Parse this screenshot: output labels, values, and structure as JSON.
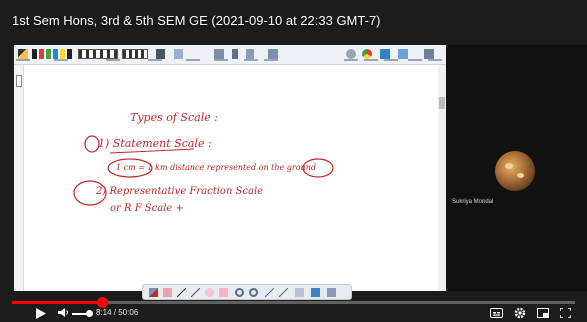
{
  "video": {
    "title": "1st Sem Hons, 3rd & 5th SEM GE (2021-09-10 at 22:33 GMT-7)",
    "progress": 0.16,
    "time_current": "8:14",
    "time_separator": " / ",
    "time_total": "50:06"
  },
  "whiteboard": {
    "lines": [
      "Types of Scale :",
      "1) Statement Scale :",
      "1 cm = 1 km distance represented on the ground",
      "2) Representative Fraction Scale",
      "or R F Scale +"
    ],
    "ink_color": "#c2282a"
  },
  "participant": {
    "name": "Sukriya Mondal"
  },
  "colors": {
    "progress": "#ff0000",
    "toolbar": "#eef1f6",
    "background": "#1c1c1c"
  },
  "icons": {
    "play": "play-icon",
    "volume": "volume-icon",
    "subtitles": "subtitles-icon",
    "settings": "settings-icon",
    "miniplayer": "miniplayer-icon",
    "fullscreen": "fullscreen-icon"
  }
}
